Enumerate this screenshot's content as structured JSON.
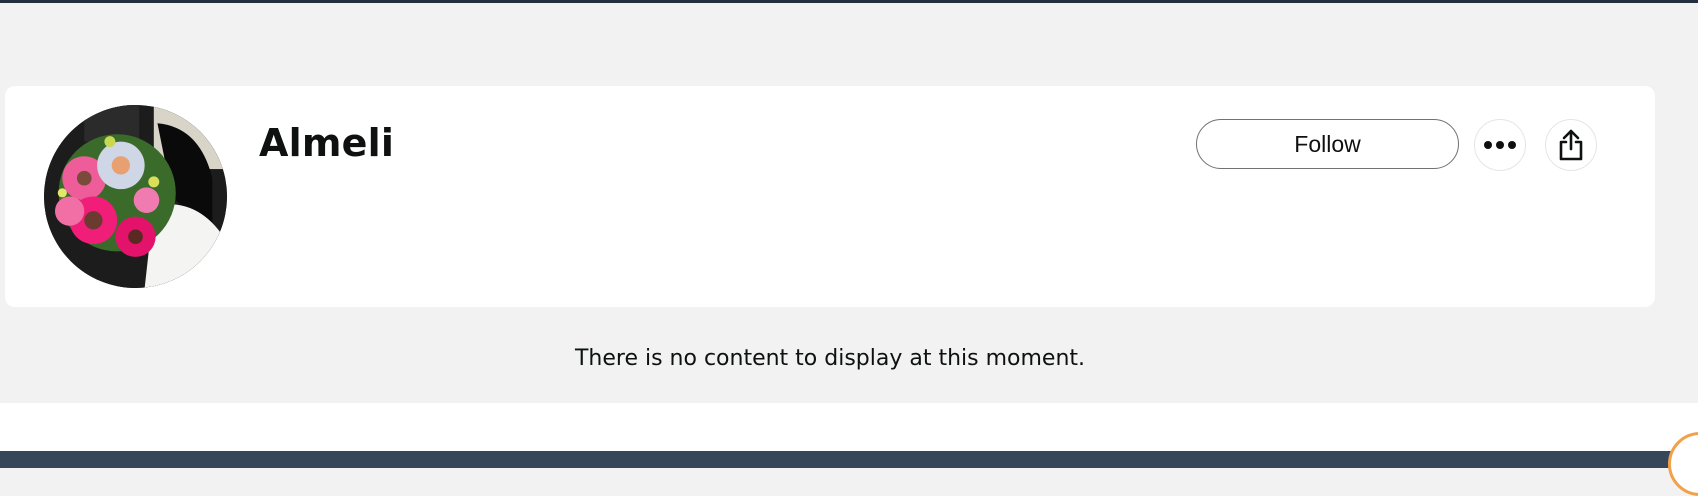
{
  "profile": {
    "name": "Almeli",
    "avatar_alt": "profile-avatar"
  },
  "actions": {
    "follow_label": "Follow",
    "more_icon": "more-options-icon",
    "share_icon": "share-icon"
  },
  "feed": {
    "empty_message": "There is no content to display at this moment."
  },
  "colors": {
    "header": "#232f3e",
    "background": "#f2f2f2",
    "card": "#ffffff",
    "footer": "#37475a",
    "accent": "#f0a14a"
  }
}
